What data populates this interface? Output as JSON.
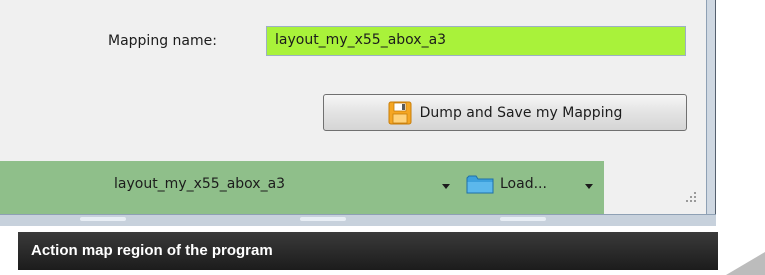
{
  "mapping": {
    "label": "Mapping name:",
    "value": "layout_my_x55_abox_a3",
    "field_color": "#a9f23a"
  },
  "dump_button": {
    "label": "Dump and Save my Mapping",
    "icon": "floppy-disk-icon"
  },
  "statusbar": {
    "map_name": "layout_my_x55_abox_a3",
    "load_label": "Load...",
    "load_icon": "folder-icon",
    "color": "#8fbf8a"
  },
  "caption": {
    "text": "Action map region of the program"
  }
}
